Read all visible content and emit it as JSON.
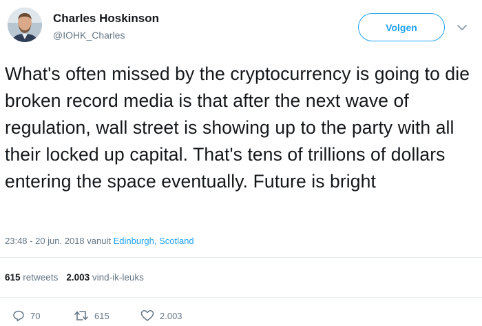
{
  "author": {
    "name": "Charles Hoskinson",
    "handle": "@IOHK_Charles"
  },
  "follow_button": {
    "label": "Volgen"
  },
  "tweet": {
    "text": "What's often missed by the cryptocurrency is going to die broken record media is that after the next wave of regulation, wall street is showing up to the party with all their locked up capital. That's tens of trillions of dollars entering the space eventually. Future is bright"
  },
  "meta": {
    "timestamp": "23:48 - 20 jun. 2018 vanuit",
    "location": "Edinburgh, Scotland"
  },
  "stats": {
    "retweets_count": "615",
    "retweets_label": "retweets",
    "likes_count": "2.003",
    "likes_label": "vind-ik-leuks"
  },
  "actions": {
    "reply_count": "70",
    "retweet_count": "615",
    "like_count": "2.003"
  },
  "icons": {
    "reply": "reply-icon",
    "retweet": "retweet-icon",
    "like": "heart-icon",
    "more": "chevron-down-icon"
  },
  "colors": {
    "accent": "#1da1f2",
    "text": "#14171a",
    "secondary": "#657786",
    "divider": "#e6ecf0"
  }
}
